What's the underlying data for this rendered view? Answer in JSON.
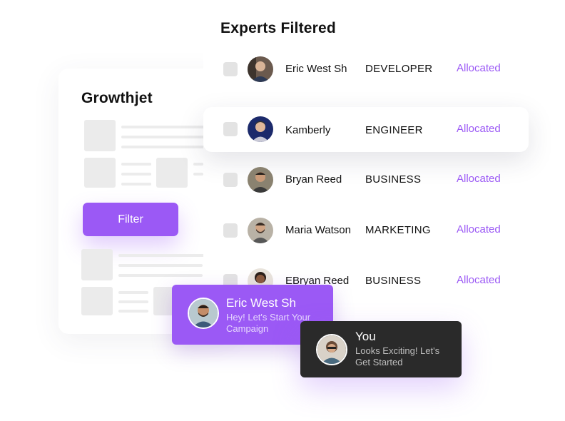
{
  "app": {
    "title": "Growthjet",
    "filter_label": "Filter"
  },
  "experts": {
    "title": "Experts Filtered",
    "rows": [
      {
        "name": "Eric West Sh",
        "role": "DEVELOPER",
        "status": "Allocated"
      },
      {
        "name": "Kamberly",
        "role": "ENGINEER",
        "status": "Allocated"
      },
      {
        "name": "Bryan Reed",
        "role": "BUSINESS",
        "status": "Allocated"
      },
      {
        "name": "Maria Watson",
        "role": "MARKETING",
        "status": "Allocated"
      },
      {
        "name": "EBryan Reed",
        "role": "BUSINESS",
        "status": "Allocated"
      }
    ]
  },
  "chat": {
    "incoming": {
      "name": "Eric West Sh",
      "message": "Hey! Let's Start Your Campaign"
    },
    "outgoing": {
      "name": "You",
      "message": "Looks Exciting! Let's Get Started"
    }
  },
  "colors": {
    "accent": "#9b59f5",
    "dark_bubble": "#2a2a2a",
    "placeholder": "#ebebeb",
    "checkbox": "#e3e3e3"
  }
}
